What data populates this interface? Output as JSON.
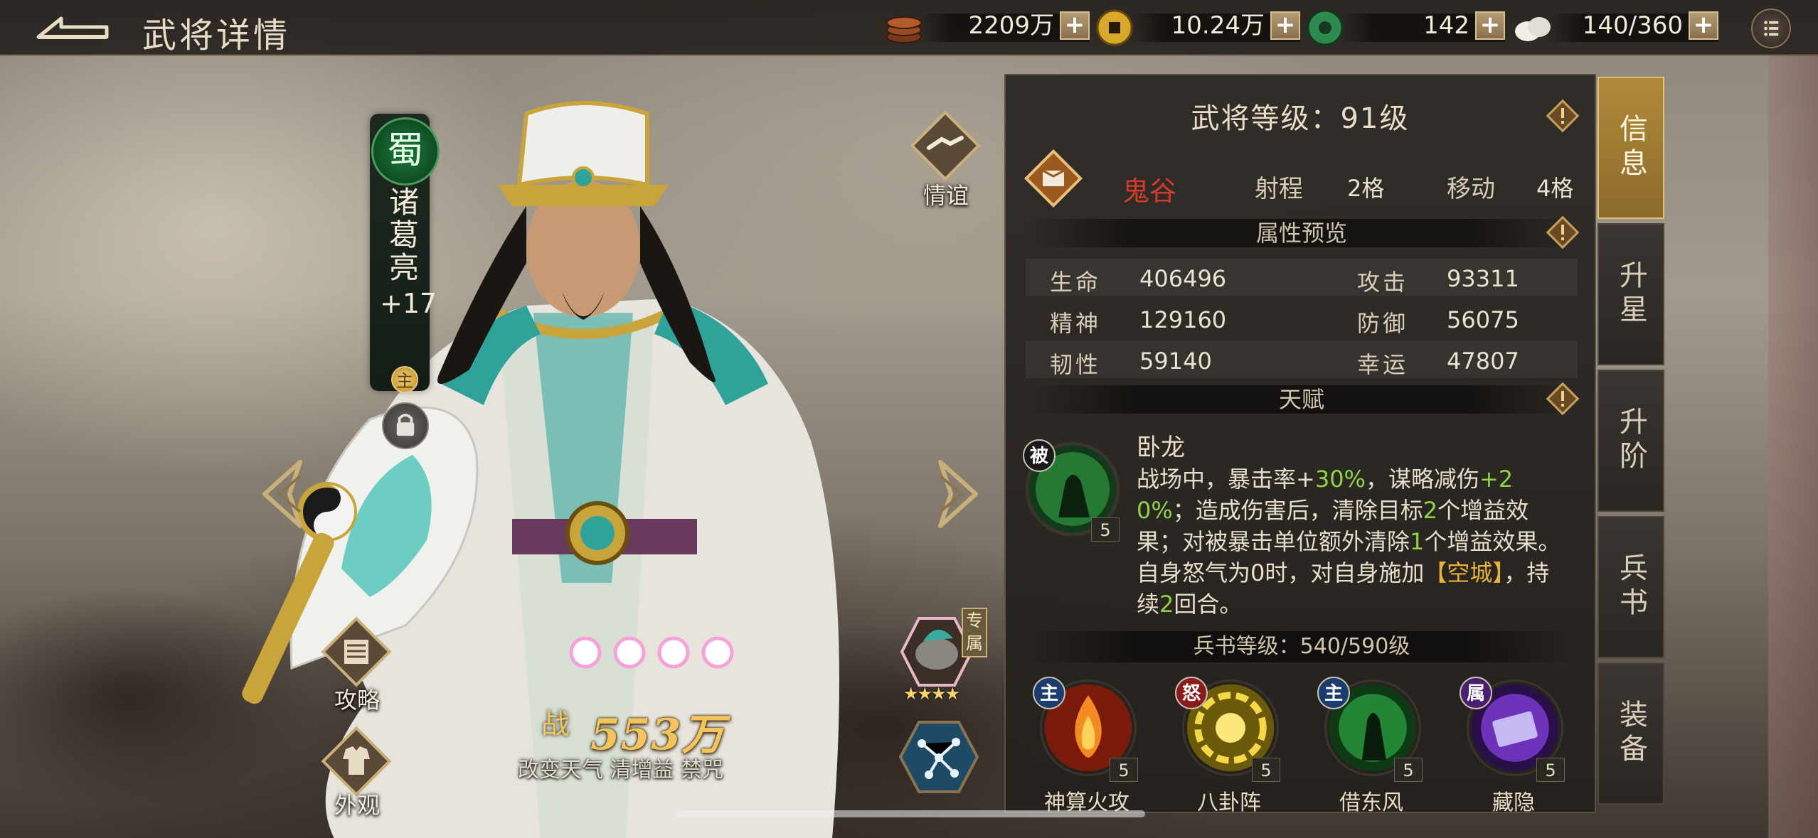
{
  "header": {
    "title": "武将详情",
    "resources": [
      {
        "icon": "copper-coins-icon",
        "value": "2209万"
      },
      {
        "icon": "gold-coin-icon",
        "value": "10.24万"
      },
      {
        "icon": "jade-icon",
        "value": "142"
      },
      {
        "icon": "stamina-icon",
        "value": "140/360"
      }
    ],
    "plus": "+"
  },
  "hero": {
    "faction": "蜀",
    "name": "诸葛亮",
    "rank": "+17",
    "main_badge": "主"
  },
  "left_buttons": {
    "friendship": "情谊",
    "strategy": "攻略",
    "appearance": "外观"
  },
  "power": {
    "label": "战",
    "value": "553万",
    "tags": "改变天气 清增益 禁咒"
  },
  "exclusive": {
    "tag": "专属",
    "stars": "★★★★"
  },
  "panel": {
    "level_title": "武将等级：91级",
    "class_name": "鬼谷",
    "range_label": "射程",
    "range_value": "2格",
    "move_label": "移动",
    "move_value": "4格",
    "attr_section": "属性预览",
    "attributes": [
      {
        "label": "生命",
        "value": "406496"
      },
      {
        "label": "攻击",
        "value": "93311"
      },
      {
        "label": "精神",
        "value": "129160"
      },
      {
        "label": "防御",
        "value": "56075"
      },
      {
        "label": "韧性",
        "value": "59140"
      },
      {
        "label": "幸运",
        "value": "47807"
      }
    ],
    "talent_section": "天赋",
    "talent": {
      "badge": "被",
      "level": "5",
      "name": "卧龙",
      "desc_parts": [
        "战场中，暴击率+",
        "30%",
        "，谋略减伤",
        "+20%",
        "；造成伤害后，清除目标",
        "2",
        "个增益效果；对被暴击单位额外清除",
        "1",
        "个增益效果。自身怒气为0时，对自身施加",
        "【空城】",
        "，持续",
        "2",
        "回合。"
      ]
    },
    "book_level": "兵书等级：540/590级",
    "skills": [
      {
        "type": "主",
        "type_color": "#1b3d6e",
        "name": "神算火攻",
        "level": "5",
        "icon": "fire-attack-icon"
      },
      {
        "type": "怒",
        "type_color": "#8a1c1c",
        "name": "八卦阵",
        "level": "5",
        "icon": "bagua-icon"
      },
      {
        "type": "主",
        "type_color": "#1b3d6e",
        "name": "借东风",
        "level": "5",
        "icon": "east-wind-icon"
      },
      {
        "type": "属",
        "type_color": "#4a1e6e",
        "name": "藏隐",
        "level": "5",
        "icon": "hidden-scroll-icon"
      }
    ]
  },
  "tabs": [
    "信息",
    "升星",
    "升阶",
    "兵书",
    "装备"
  ],
  "colors": {
    "accent": "#b08a3c",
    "red_class": "#d43a2a",
    "green_highlight": "#8fd24a",
    "power_gold": "#f3c45c"
  }
}
